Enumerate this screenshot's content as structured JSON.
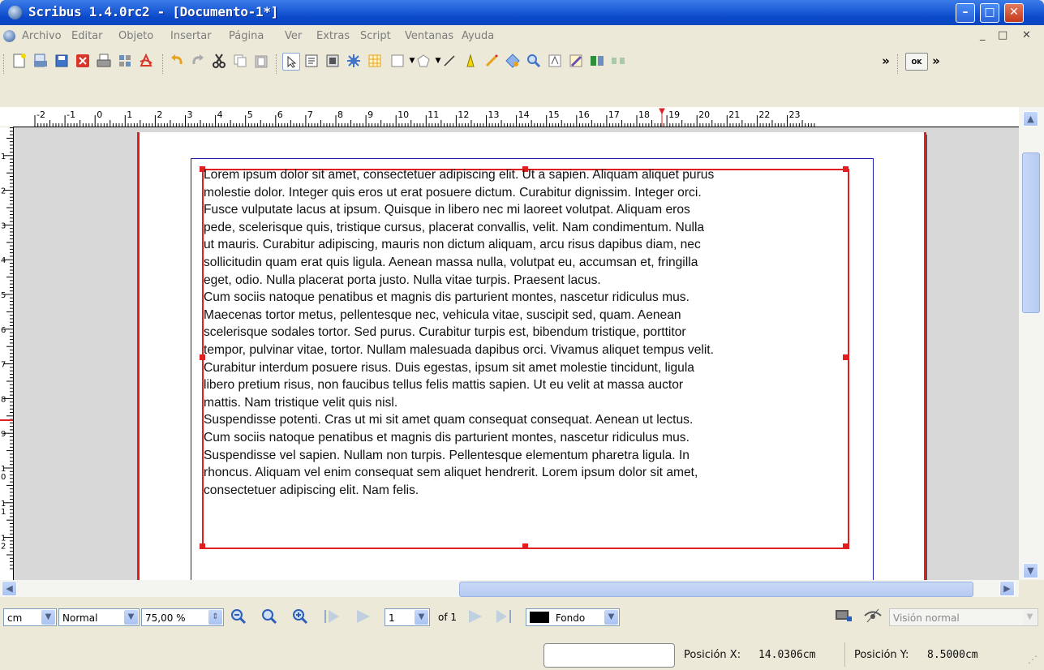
{
  "window": {
    "title": "Scribus 1.4.0rc2 - [Documento-1*]",
    "min_glyph": "–",
    "max_glyph": "□",
    "close_glyph": "✕"
  },
  "menubar": {
    "items": [
      "Archivo",
      "Editar",
      "Objeto",
      "Insertar",
      "Página",
      "Ver",
      "Extras",
      "Script",
      "Ventanas",
      "Ayuda"
    ],
    "mdi_min": "_",
    "mdi_restore": "□",
    "mdi_close": "✕"
  },
  "toolbar": {
    "more_glyph": "»",
    "ok_label": "OK"
  },
  "rulers": {
    "horizontal_ticks": [
      "-2",
      "-1",
      "0",
      "1",
      "2",
      "3",
      "4",
      "5",
      "6",
      "7",
      "8",
      "9",
      "10",
      "11",
      "12",
      "13",
      "14",
      "15",
      "16",
      "17",
      "18",
      "19",
      "20",
      "21",
      "22",
      "23"
    ],
    "vertical_ticks": [
      "1",
      "2",
      "3",
      "4",
      "5",
      "6",
      "7",
      "8",
      "9",
      "10",
      "11",
      "12"
    ]
  },
  "document": {
    "text": "Lorem ipsum dolor sit amet, consectetuer adipiscing elit. Ut a sapien. Aliquam aliquet purus\nmolestie dolor. Integer quis eros ut erat posuere dictum. Curabitur dignissim. Integer orci.\nFusce vulputate lacus at ipsum. Quisque in libero nec mi laoreet volutpat. Aliquam eros\npede, scelerisque quis, tristique cursus, placerat convallis, velit. Nam condimentum. Nulla\nut mauris. Curabitur adipiscing, mauris non dictum aliquam, arcu risus dapibus diam, nec\nsollicitudin quam erat quis ligula. Aenean massa nulla, volutpat eu, accumsan et, fringilla\neget, odio. Nulla placerat porta justo. Nulla vitae turpis. Praesent lacus.\nCum sociis natoque penatibus et magnis dis parturient montes, nascetur ridiculus mus.\nMaecenas tortor metus, pellentesque nec, vehicula vitae, suscipit sed, quam. Aenean\nscelerisque sodales tortor. Sed purus. Curabitur turpis est, bibendum tristique, porttitor\ntempor, pulvinar vitae, tortor. Nullam malesuada dapibus orci. Vivamus aliquet tempus velit.\nCurabitur interdum posuere risus. Duis egestas, ipsum sit amet molestie tincidunt, ligula\nlibero pretium risus, non faucibus tellus felis mattis sapien. Ut eu velit at massa auctor\nmattis. Nam tristique velit quis nisl.\nSuspendisse potenti. Cras ut mi sit amet quam consequat consequat. Aenean ut lectus.\nCum sociis natoque penatibus et magnis dis parturient montes, nascetur ridiculus mus.\nSuspendisse vel sapien. Nullam non turpis. Pellentesque elementum pharetra ligula. In\nrhoncus. Aliquam vel enim consequat sem aliquet hendrerit. Lorem ipsum dolor sit amet,\nconsectetuer adipiscing elit. Nam felis."
  },
  "bottombar": {
    "unit": "cm",
    "mode": "Normal",
    "zoom": "75,00 %",
    "page": "1",
    "of_pages": "of 1",
    "layer": "Fondo",
    "layer_color": "#000000",
    "view_mode": "Visión normal"
  },
  "status": {
    "pos_x_label": "Posición X:",
    "pos_x_value": "14.0306cm",
    "pos_y_label": "Posición Y:",
    "pos_y_value": "8.5000cm"
  },
  "colors": {
    "titlebar": "#0a49c9",
    "frame_selection": "#e02020",
    "margin_guide": "#1c1ca8",
    "canvas_bg": "#d8d8d8"
  }
}
